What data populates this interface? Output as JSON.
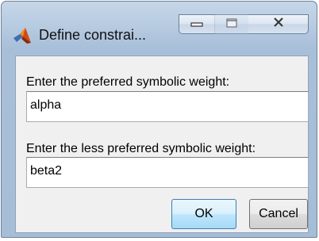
{
  "window": {
    "title": "Define constrai...",
    "icon": "matlab-logo-icon",
    "controls": {
      "minimize": "minimize-icon",
      "maximize": "maximize-icon",
      "close": "close-icon"
    }
  },
  "form": {
    "preferred_label": "Enter the preferred symbolic weight:",
    "preferred_value": "alpha",
    "less_preferred_label": "Enter the less preferred symbolic weight:",
    "less_preferred_value": "beta2"
  },
  "buttons": {
    "ok_label": "OK",
    "cancel_label": "Cancel"
  },
  "colors": {
    "title_bar": "#b7cbe1",
    "client_bg": "#f0f0f0",
    "ok_accent": "#3c7fb1"
  }
}
